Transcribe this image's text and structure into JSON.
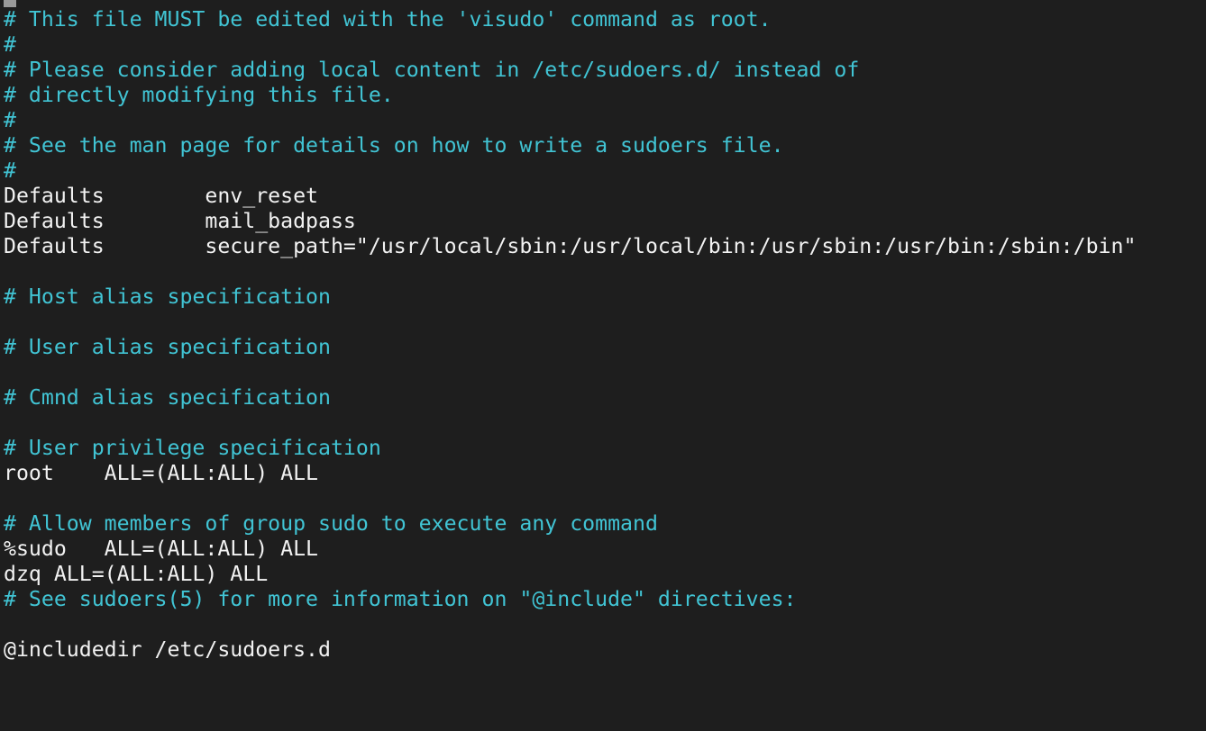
{
  "colors": {
    "background": "#1e1e1e",
    "comment": "#41c4d4",
    "text": "#f2f2f2",
    "cursor": "#9a9a9a"
  },
  "lines": [
    {
      "type": "comment",
      "text": "# This file MUST be edited with the 'visudo' command as root."
    },
    {
      "type": "comment",
      "text": "#"
    },
    {
      "type": "comment",
      "text": "# Please consider adding local content in /etc/sudoers.d/ instead of"
    },
    {
      "type": "comment",
      "text": "# directly modifying this file."
    },
    {
      "type": "comment",
      "text": "#"
    },
    {
      "type": "comment",
      "text": "# See the man page for details on how to write a sudoers file."
    },
    {
      "type": "comment",
      "text": "#"
    },
    {
      "type": "text",
      "text": "Defaults        env_reset"
    },
    {
      "type": "text",
      "text": "Defaults        mail_badpass"
    },
    {
      "type": "text",
      "text": "Defaults        secure_path=\"/usr/local/sbin:/usr/local/bin:/usr/sbin:/usr/bin:/sbin:/bin\""
    },
    {
      "type": "text",
      "text": ""
    },
    {
      "type": "comment",
      "text": "# Host alias specification"
    },
    {
      "type": "text",
      "text": ""
    },
    {
      "type": "comment",
      "text": "# User alias specification"
    },
    {
      "type": "text",
      "text": ""
    },
    {
      "type": "comment",
      "text": "# Cmnd alias specification"
    },
    {
      "type": "text",
      "text": ""
    },
    {
      "type": "comment",
      "text": "# User privilege specification"
    },
    {
      "type": "text",
      "text": "root    ALL=(ALL:ALL) ALL"
    },
    {
      "type": "text",
      "text": ""
    },
    {
      "type": "comment",
      "text": "# Allow members of group sudo to execute any command"
    },
    {
      "type": "text",
      "text": "%sudo   ALL=(ALL:ALL) ALL"
    },
    {
      "type": "text",
      "text": "dzq ALL=(ALL:ALL) ALL"
    },
    {
      "type": "comment",
      "text": "# See sudoers(5) for more information on \"@include\" directives:"
    },
    {
      "type": "text",
      "text": ""
    },
    {
      "type": "text",
      "text": "@includedir /etc/sudoers.d"
    }
  ]
}
